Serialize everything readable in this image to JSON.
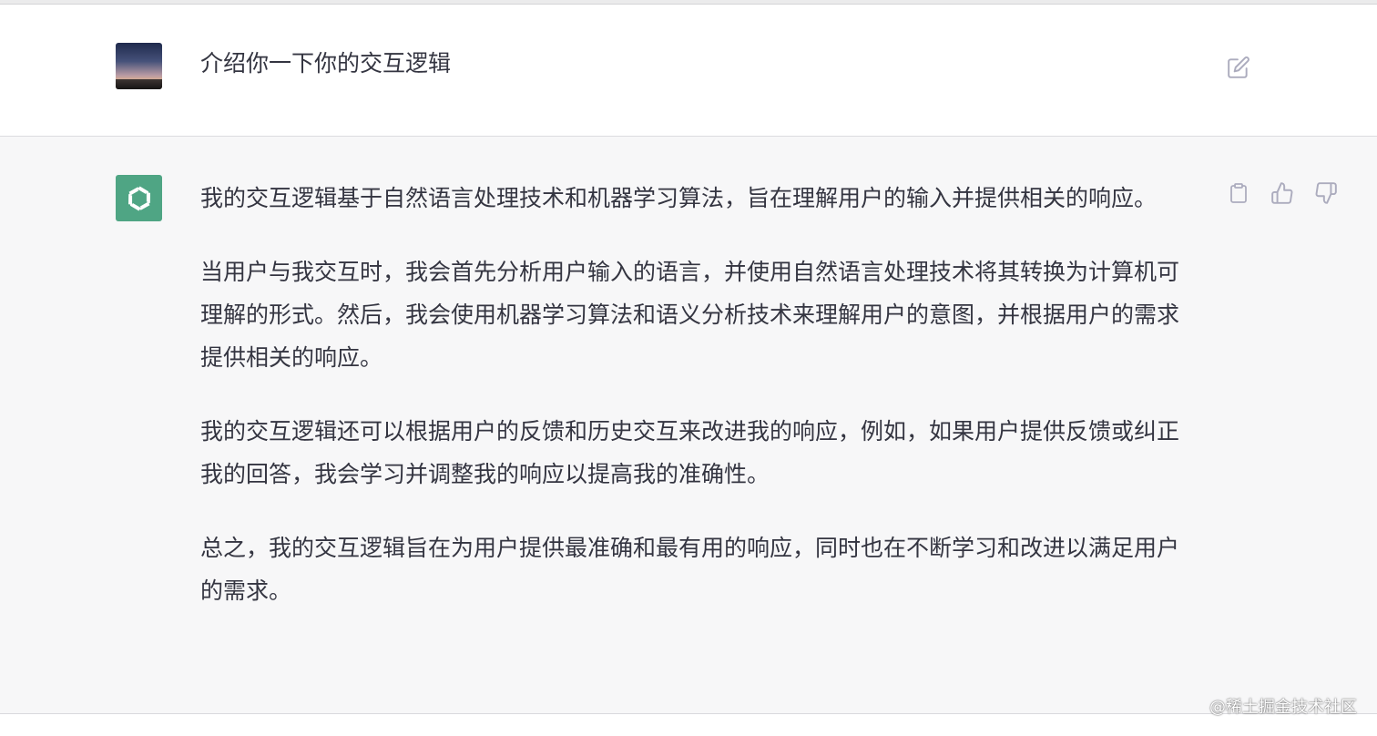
{
  "colors": {
    "assistant_bg": "#f7f7f8",
    "user_bg": "#ffffff",
    "text": "#343541",
    "icon": "#acacbe",
    "gpt_avatar_bg": "#4fa584"
  },
  "user_message": {
    "text": "介绍你一下你的交互逻辑",
    "edit_icon": "edit-icon"
  },
  "assistant_message": {
    "paragraphs": [
      "我的交互逻辑基于自然语言处理技术和机器学习算法，旨在理解用户的输入并提供相关的响应。",
      "当用户与我交互时，我会首先分析用户输入的语言，并使用自然语言处理技术将其转换为计算机可理解的形式。然后，我会使用机器学习算法和语义分析技术来理解用户的意图，并根据用户的需求提供相关的响应。",
      "我的交互逻辑还可以根据用户的反馈和历史交互来改进我的响应，例如，如果用户提供反馈或纠正我的回答，我会学习并调整我的响应以提高我的准确性。",
      "总之，我的交互逻辑旨在为用户提供最准确和最有用的响应，同时也在不断学习和改进以满足用户的需求。"
    ],
    "icons": [
      "copy-icon",
      "thumbs-up-icon",
      "thumbs-down-icon"
    ]
  },
  "watermark": "@稀土掘金技术社区"
}
